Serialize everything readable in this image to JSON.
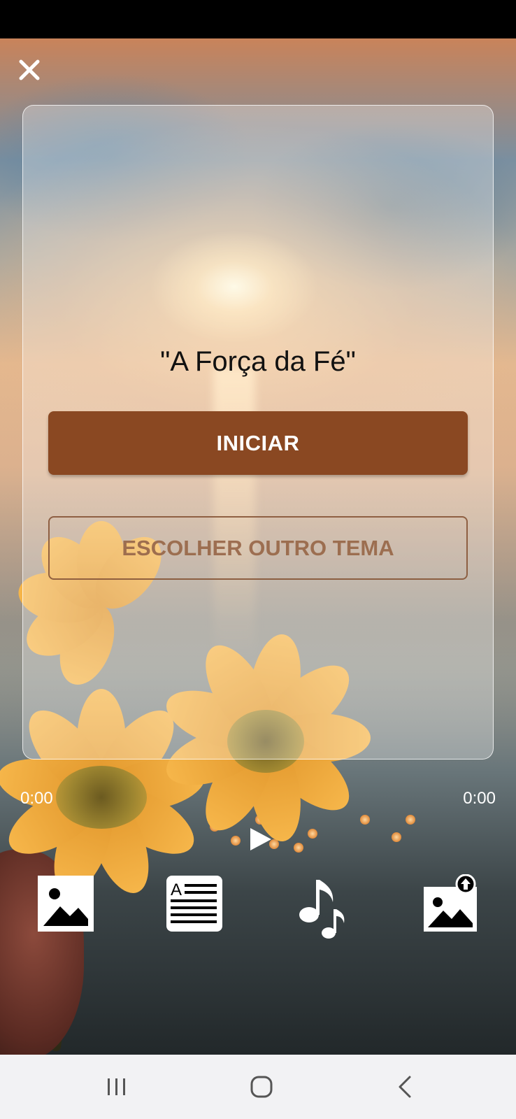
{
  "theme": {
    "title": "\"A Força da Fé\""
  },
  "buttons": {
    "start_label": "INICIAR",
    "choose_theme_label": "ESCOLHER OUTRO TEMA"
  },
  "player": {
    "current_time": "0:00",
    "total_time": "0:00"
  },
  "toolbar": {
    "items": [
      "image-icon",
      "text-document-icon",
      "music-note-icon",
      "upload-image-icon"
    ]
  },
  "colors": {
    "start_button": "#8a4822",
    "choose_button_border": "#8a5a3c",
    "nav_bar": "#f2f2f4"
  }
}
